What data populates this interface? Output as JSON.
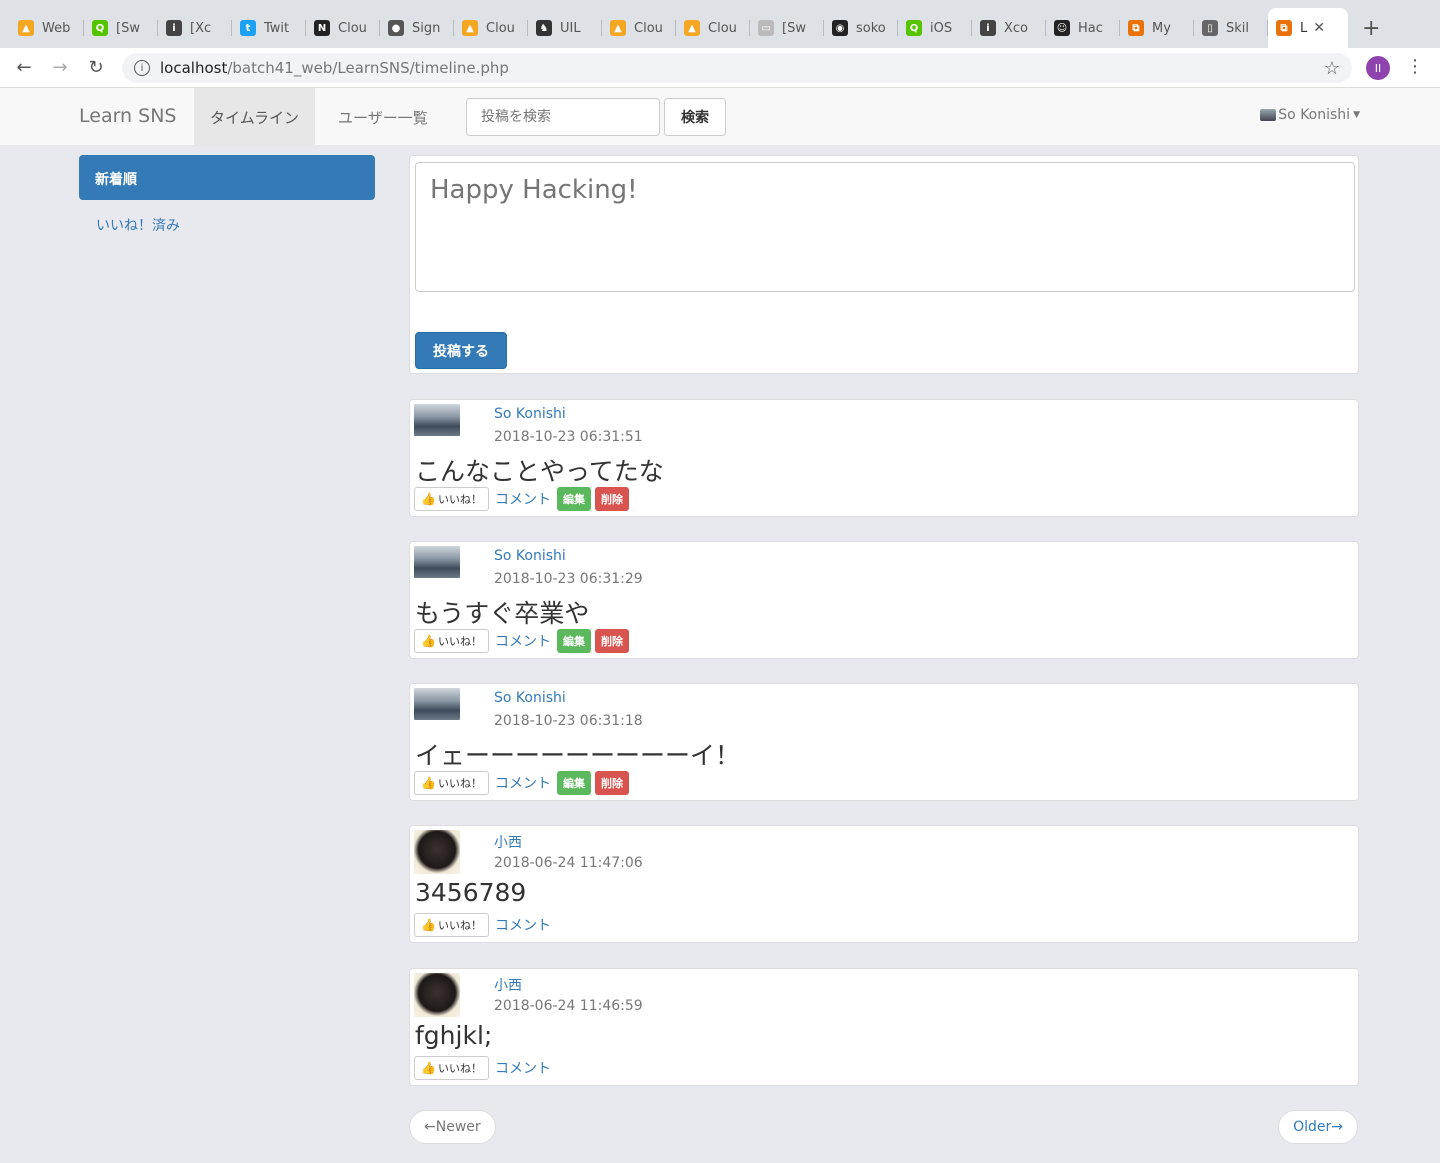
{
  "browser": {
    "tabs": [
      {
        "label": "Web",
        "icon": "firebase-icon",
        "color": "#f5a623"
      },
      {
        "label": "[Sw",
        "icon": "qiita-icon",
        "color": "#55c500"
      },
      {
        "label": "[Xc",
        "icon": "info-icon",
        "color": "#444444"
      },
      {
        "label": "Twit",
        "icon": "twitter-icon",
        "color": "#1da1f2"
      },
      {
        "label": "Clou",
        "icon": "notion-icon",
        "color": "#222222"
      },
      {
        "label": "Sign",
        "icon": "apple-icon",
        "color": "#555555"
      },
      {
        "label": "Clou",
        "icon": "firebase-icon",
        "color": "#f5a623"
      },
      {
        "label": "UIL",
        "icon": "figure-icon",
        "color": "#333333"
      },
      {
        "label": "Clou",
        "icon": "firebase-icon",
        "color": "#f5a623"
      },
      {
        "label": "Clou",
        "icon": "firebase-icon",
        "color": "#f5a623"
      },
      {
        "label": "[Sw",
        "icon": "page-icon",
        "color": "#bbbbbb"
      },
      {
        "label": "soko",
        "icon": "github-icon",
        "color": "#222222"
      },
      {
        "label": "iOS",
        "icon": "qiita-icon",
        "color": "#55c500"
      },
      {
        "label": "Xco",
        "icon": "info-icon",
        "color": "#444444"
      },
      {
        "label": "Hac",
        "icon": "hacker-icon",
        "color": "#222222"
      },
      {
        "label": "My",
        "icon": "box-icon",
        "color": "#e8710a"
      },
      {
        "label": "Skil",
        "icon": "document-icon",
        "color": "#666666"
      }
    ],
    "active_tab": {
      "label": "L",
      "icon": "box-icon",
      "color": "#e8710a"
    },
    "url_host": "localhost",
    "url_path": "/batch41_web/LearnSNS/timeline.php",
    "profile_initial": "II"
  },
  "navbar": {
    "brand": "Learn SNS",
    "tab_timeline": "タイムライン",
    "tab_users": "ユーザー一覧",
    "search_placeholder": "投稿を検索",
    "search_button": "検索",
    "user_name": "So Konishi"
  },
  "sidebar": {
    "active_label": "新着順",
    "link_label": "いいね！済み"
  },
  "compose": {
    "placeholder": "Happy Hacking!",
    "submit_label": "投稿する"
  },
  "actions": {
    "like": "いいね！",
    "comment": "コメント",
    "edit": "編集",
    "delete": "削除"
  },
  "feeds": [
    {
      "name": "So Konishi",
      "date": "2018-10-23 06:31:51",
      "content": "こんなことやってたな"
    },
    {
      "name": "So Konishi",
      "date": "2018-10-23 06:31:29",
      "content": "もうすぐ卒業や"
    },
    {
      "name": "So Konishi",
      "date": "2018-10-23 06:31:18",
      "content": "イェーーーーーーーーーイ！"
    },
    {
      "name": "小西",
      "date": "2018-06-24 11:47:06",
      "content": "3456789"
    },
    {
      "name": "小西",
      "date": "2018-06-24 11:46:59",
      "content": "fghjkl;"
    }
  ],
  "pager": {
    "newer": "←Newer",
    "older": "Older→"
  }
}
